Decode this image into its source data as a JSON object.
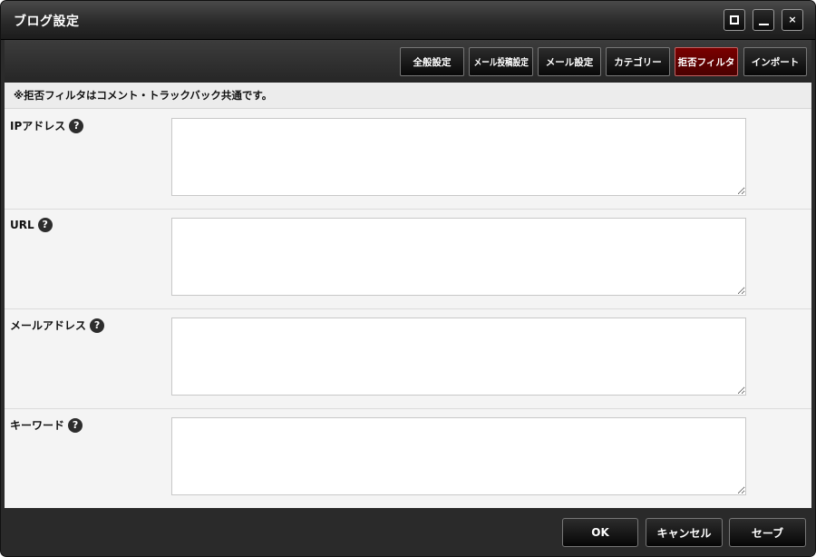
{
  "window": {
    "title": "ブログ設定",
    "controls": {
      "maximize_icon": "maximize-icon",
      "minimize_icon": "minimize-icon",
      "close_glyph": "×"
    }
  },
  "tabs": [
    {
      "label": "全般設定",
      "active": false
    },
    {
      "label": "メール投稿設定",
      "active": false
    },
    {
      "label": "メール設定",
      "active": false
    },
    {
      "label": "カテゴリー",
      "active": false
    },
    {
      "label": "拒否フィルタ",
      "active": true
    },
    {
      "label": "インポート",
      "active": false
    }
  ],
  "notice": "※拒否フィルタはコメント・トラックバック共通です。",
  "fields": [
    {
      "label": "IPアドレス",
      "value": ""
    },
    {
      "label": "URL",
      "value": ""
    },
    {
      "label": "メールアドレス",
      "value": ""
    },
    {
      "label": "キーワード",
      "value": ""
    }
  ],
  "help_glyph": "?",
  "footer": {
    "ok_label": "OK",
    "cancel_label": "キャンセル",
    "save_label": "セーブ"
  },
  "colors": {
    "active_tab": "#5a0000",
    "chrome": "#2b2b2b",
    "content_bg": "#f4f4f4"
  }
}
